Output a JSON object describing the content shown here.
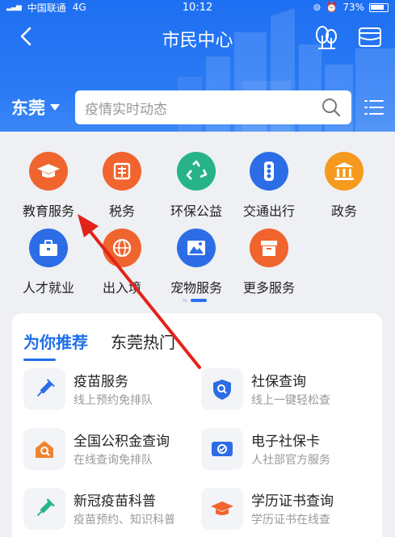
{
  "status_bar": {
    "carrier": "中国联通",
    "network": "4G",
    "time": "10:12",
    "battery": "73%"
  },
  "navbar": {
    "title": "市民中心"
  },
  "location": {
    "city": "东莞"
  },
  "search": {
    "placeholder": "疫情实时动态"
  },
  "services": [
    {
      "label": "教育服务",
      "icon": "graduation-cap-icon",
      "color": "#f0642e"
    },
    {
      "label": "税务",
      "icon": "tax-icon",
      "color": "#f0642e"
    },
    {
      "label": "环保公益",
      "icon": "recycle-icon",
      "color": "#26b38a"
    },
    {
      "label": "交通出行",
      "icon": "traffic-light-icon",
      "color": "#2c6de6"
    },
    {
      "label": "政务",
      "icon": "government-icon",
      "color": "#f59a1e"
    },
    {
      "label": "人才就业",
      "icon": "briefcase-icon",
      "color": "#2c6de6"
    },
    {
      "label": "出入境",
      "icon": "globe-plane-icon",
      "color": "#f0642e"
    },
    {
      "label": "宠物服务",
      "icon": "mountain-image-icon",
      "color": "#2c6de6"
    },
    {
      "label": "更多服务",
      "icon": "box-icon",
      "color": "#f0642e"
    }
  ],
  "tabs": [
    {
      "label": "为你推荐",
      "active": true
    },
    {
      "label": "东莞热门",
      "active": false
    }
  ],
  "recommendations": [
    {
      "title": "疫苗服务",
      "subtitle": "线上预约免排队",
      "icon": "syringe-icon",
      "color": "#2c6de6"
    },
    {
      "title": "社保查询",
      "subtitle": "线上一键轻松查",
      "icon": "shield-search-icon",
      "color": "#2c6de6"
    },
    {
      "title": "全国公积金查询",
      "subtitle": "在线查询免排队",
      "icon": "house-search-icon",
      "color": "#f0642e"
    },
    {
      "title": "电子社保卡",
      "subtitle": "人社部官方服务",
      "icon": "social-card-icon",
      "color": "#2c6de6"
    },
    {
      "title": "新冠疫苗科普",
      "subtitle": "疫苗预约、知识科普",
      "icon": "vaccine-icon",
      "color": "#26b38a"
    },
    {
      "title": "学历证书查询",
      "subtitle": "学历证书在线查",
      "icon": "graduation-cap-icon",
      "color": "#f0642e"
    }
  ],
  "colors": {
    "primary": "#1f6fe8",
    "header": "#2b7bf5"
  }
}
